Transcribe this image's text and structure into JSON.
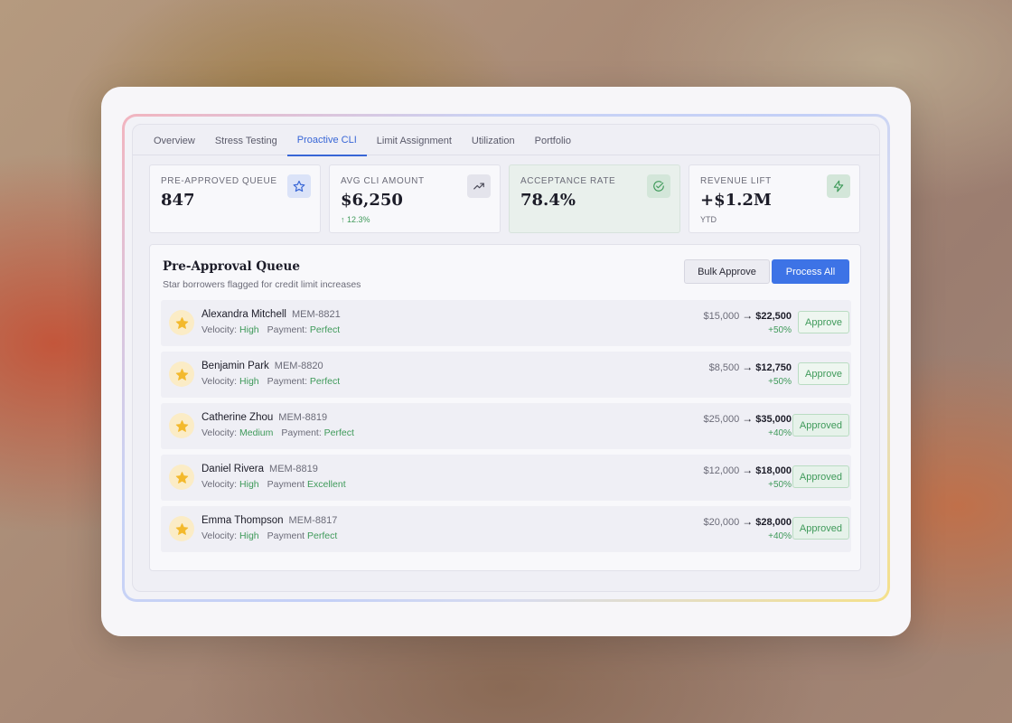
{
  "tabs": [
    {
      "label": "Overview",
      "active": false
    },
    {
      "label": "Stress Testing",
      "active": false
    },
    {
      "label": "Proactive CLI",
      "active": true
    },
    {
      "label": "Limit Assignment",
      "active": false
    },
    {
      "label": "Utilization",
      "active": false
    },
    {
      "label": "Portfolio",
      "active": false
    }
  ],
  "metrics": [
    {
      "label": "PRE-APPROVED QUEUE",
      "value": "847",
      "sub": "",
      "icon": "star-icon",
      "icon_bg": "#dbe3f8",
      "icon_color": "#3866d6"
    },
    {
      "label": "AVG CLI AMOUNT",
      "value": "$6,250",
      "sub": "↑ 12.3%",
      "icon": "trending-up-icon",
      "icon_bg": "#e4e4ec",
      "icon_color": "#4a4a58"
    },
    {
      "label": "ACCEPTANCE RATE",
      "value": "78.4%",
      "sub": "",
      "icon": "check-circle-icon",
      "icon_bg": "#d3e6d9",
      "icon_color": "#3f9a5a"
    },
    {
      "label": "REVENUE LIFT",
      "value": "+$1.2M",
      "sub": "YTD",
      "icon": "lightning-icon",
      "icon_bg": "#d3e6d9",
      "icon_color": "#3f9a5a"
    }
  ],
  "queue": {
    "title": "Pre-Approval Queue",
    "subtitle": "Star borrowers flagged for credit limit increases",
    "bulk_label": "Bulk Approve",
    "process_label": "Process All"
  },
  "rows": [
    {
      "name": "Alexandra Mitchell",
      "member": "MEM-8821",
      "velocity_label": "Velocity:",
      "velocity": "High",
      "payment_label": "Payment:",
      "payment": "Perfect",
      "old": "$15,000",
      "arrow": "→",
      "new": "$22,500",
      "pct": "+50%",
      "action": "Approve",
      "done": false
    },
    {
      "name": "Benjamin Park",
      "member": "MEM-8820",
      "velocity_label": "Velocity:",
      "velocity": "High",
      "payment_label": "Payment:",
      "payment": "Perfect",
      "old": "$8,500",
      "arrow": "→",
      "new": "$12,750",
      "pct": "+50%",
      "action": "Approve",
      "done": false
    },
    {
      "name": "Catherine Zhou",
      "member": "MEM-8819",
      "velocity_label": "Velocity:",
      "velocity": "Medium",
      "payment_label": "Payment:",
      "payment": "Perfect",
      "old": "$25,000",
      "arrow": "→",
      "new": "$35,000",
      "pct": "+40%",
      "action": "Approved",
      "done": true
    },
    {
      "name": "Daniel Rivera",
      "member": "MEM-8819",
      "velocity_label": "Velocity:",
      "velocity": "High",
      "payment_label": "Payment",
      "payment": "Excellent",
      "old": "$12,000",
      "arrow": "→",
      "new": "$18,000",
      "pct": "+50%",
      "action": "Approved",
      "done": true
    },
    {
      "name": "Emma Thompson",
      "member": "MEM-8817",
      "velocity_label": "Velocity:",
      "velocity": "High",
      "payment_label": "Payment",
      "payment": "Perfect",
      "old": "$20,000",
      "arrow": "→",
      "new": "$28,000",
      "pct": "+40%",
      "action": "Approved",
      "done": true
    }
  ]
}
